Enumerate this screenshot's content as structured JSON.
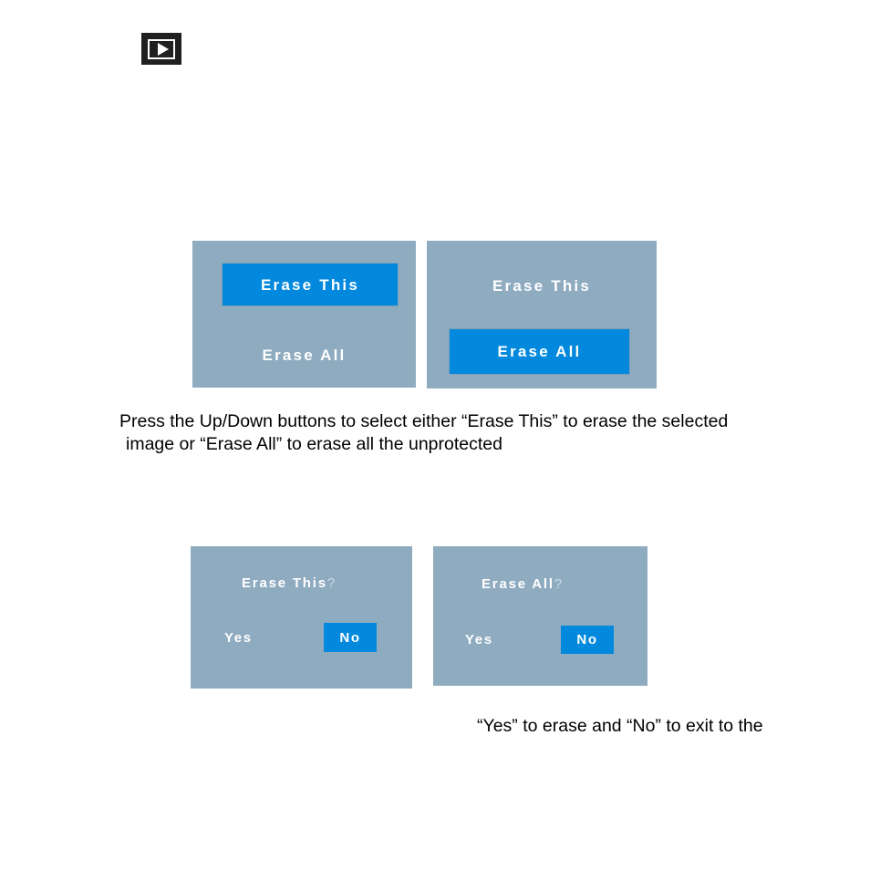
{
  "page": {
    "background": "#ffffff",
    "lcd_background": "#8fabc0",
    "highlight_color": "#0289dd",
    "text_color": "#ffffff",
    "body_text_color": "#000000"
  },
  "badge": {
    "icon": "play-icon",
    "background": "#221f1f"
  },
  "menu_screens": [
    {
      "name": "erase-this-selected",
      "options": [
        {
          "label": "Erase This",
          "selected": true
        },
        {
          "label": "Erase All",
          "selected": false
        }
      ]
    },
    {
      "name": "erase-all-selected",
      "options": [
        {
          "label": "Erase This",
          "selected": false
        },
        {
          "label": "Erase All",
          "selected": true
        }
      ]
    }
  ],
  "confirm_screens": [
    {
      "name": "confirm-erase-this",
      "title": "Erase This",
      "question_mark": "?",
      "options": [
        {
          "label": "Yes",
          "selected": false
        },
        {
          "label": "No",
          "selected": true
        }
      ]
    },
    {
      "name": "confirm-erase-all",
      "title": "Erase All",
      "question_mark": "?",
      "options": [
        {
          "label": "Yes",
          "selected": false
        },
        {
          "label": "No",
          "selected": true
        }
      ]
    }
  ],
  "instructions": {
    "line1": "Press the Up/Down buttons to select either “Erase This” to erase the selected",
    "line2": "image or “Erase All” to erase all the unprotected"
  },
  "tail": {
    "line1": "“Yes” to erase and “No” to exit to the"
  }
}
